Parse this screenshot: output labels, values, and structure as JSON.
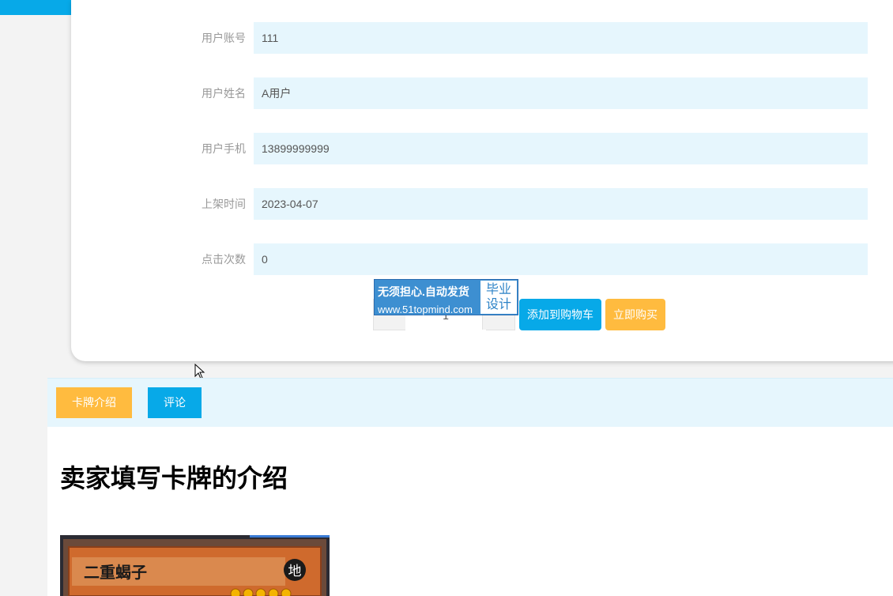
{
  "details": {
    "fields": [
      {
        "label": "用户账号",
        "value": "111"
      },
      {
        "label": "用户姓名",
        "value": "A用户"
      },
      {
        "label": "用户手机",
        "value": "13899999999"
      },
      {
        "label": "上架时间",
        "value": "2023-04-07"
      },
      {
        "label": "点击次数",
        "value": "0"
      }
    ],
    "quantity": "1",
    "add_to_cart_label": "添加到购物车",
    "buy_now_label": "立即购买"
  },
  "watermark": {
    "line1": "无须担心.自动发货",
    "line2": "www.51topmind.com",
    "side_line1": "毕业",
    "side_line2": "设计"
  },
  "tabs": [
    {
      "label": "卡牌介绍"
    },
    {
      "label": "评论"
    }
  ],
  "content": {
    "title": "卖家填写卡牌的介绍",
    "card_name": "二重蝎子",
    "card_attribute": "地"
  },
  "colors": {
    "primary": "#07a9e8",
    "accent": "#ffbb3f",
    "field_bg": "#e6f6fd"
  }
}
